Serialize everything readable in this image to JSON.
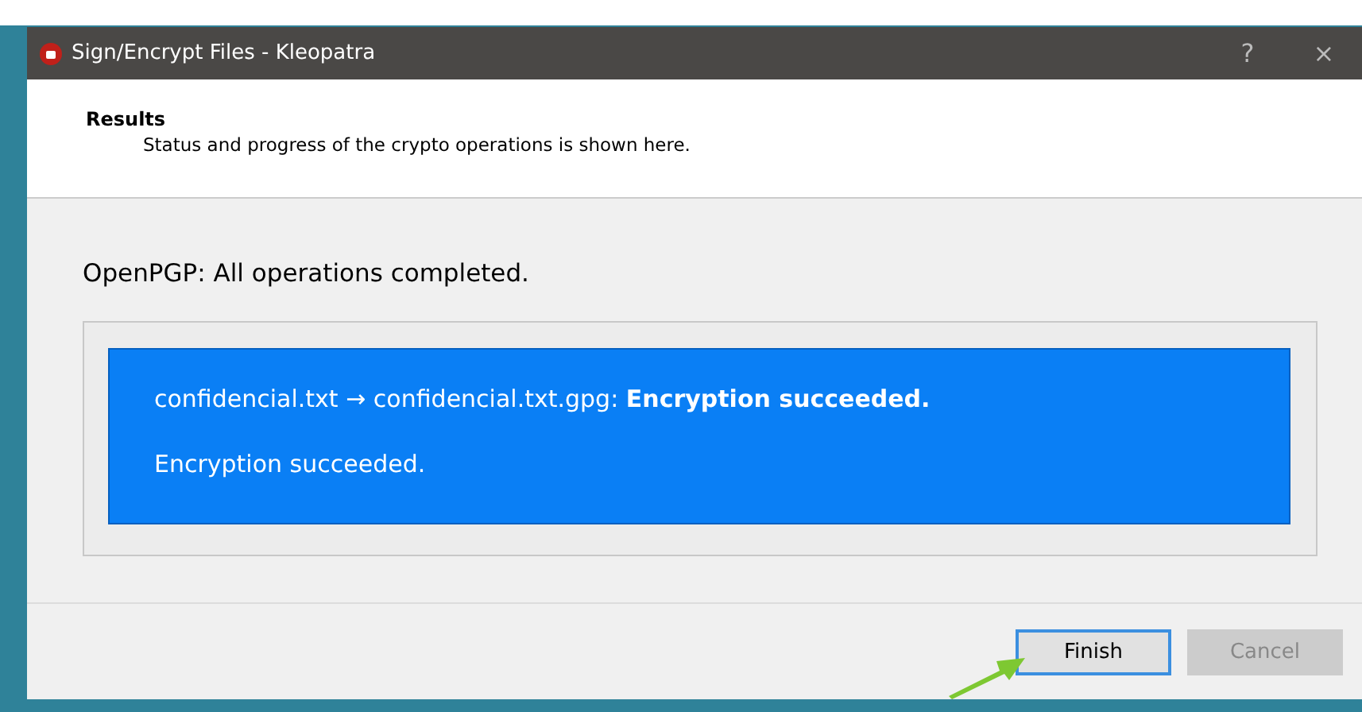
{
  "window": {
    "title": "Sign/Encrypt Files - Kleopatra",
    "help": "?",
    "close": "×"
  },
  "header": {
    "title": "Results",
    "subtitle": "Status and progress of the crypto operations is shown here."
  },
  "status": "OpenPGP: All operations completed.",
  "results": [
    {
      "text": "confidencial.txt → confidencial.txt.gpg: **Encryption succeeded.**"
    },
    {
      "text": "Encryption succeeded."
    }
  ],
  "buttons": [
    {
      "label": "Finish",
      "disabled": false,
      "focused": true
    },
    {
      "label": "Cancel",
      "disabled": true,
      "focused": false
    }
  ]
}
